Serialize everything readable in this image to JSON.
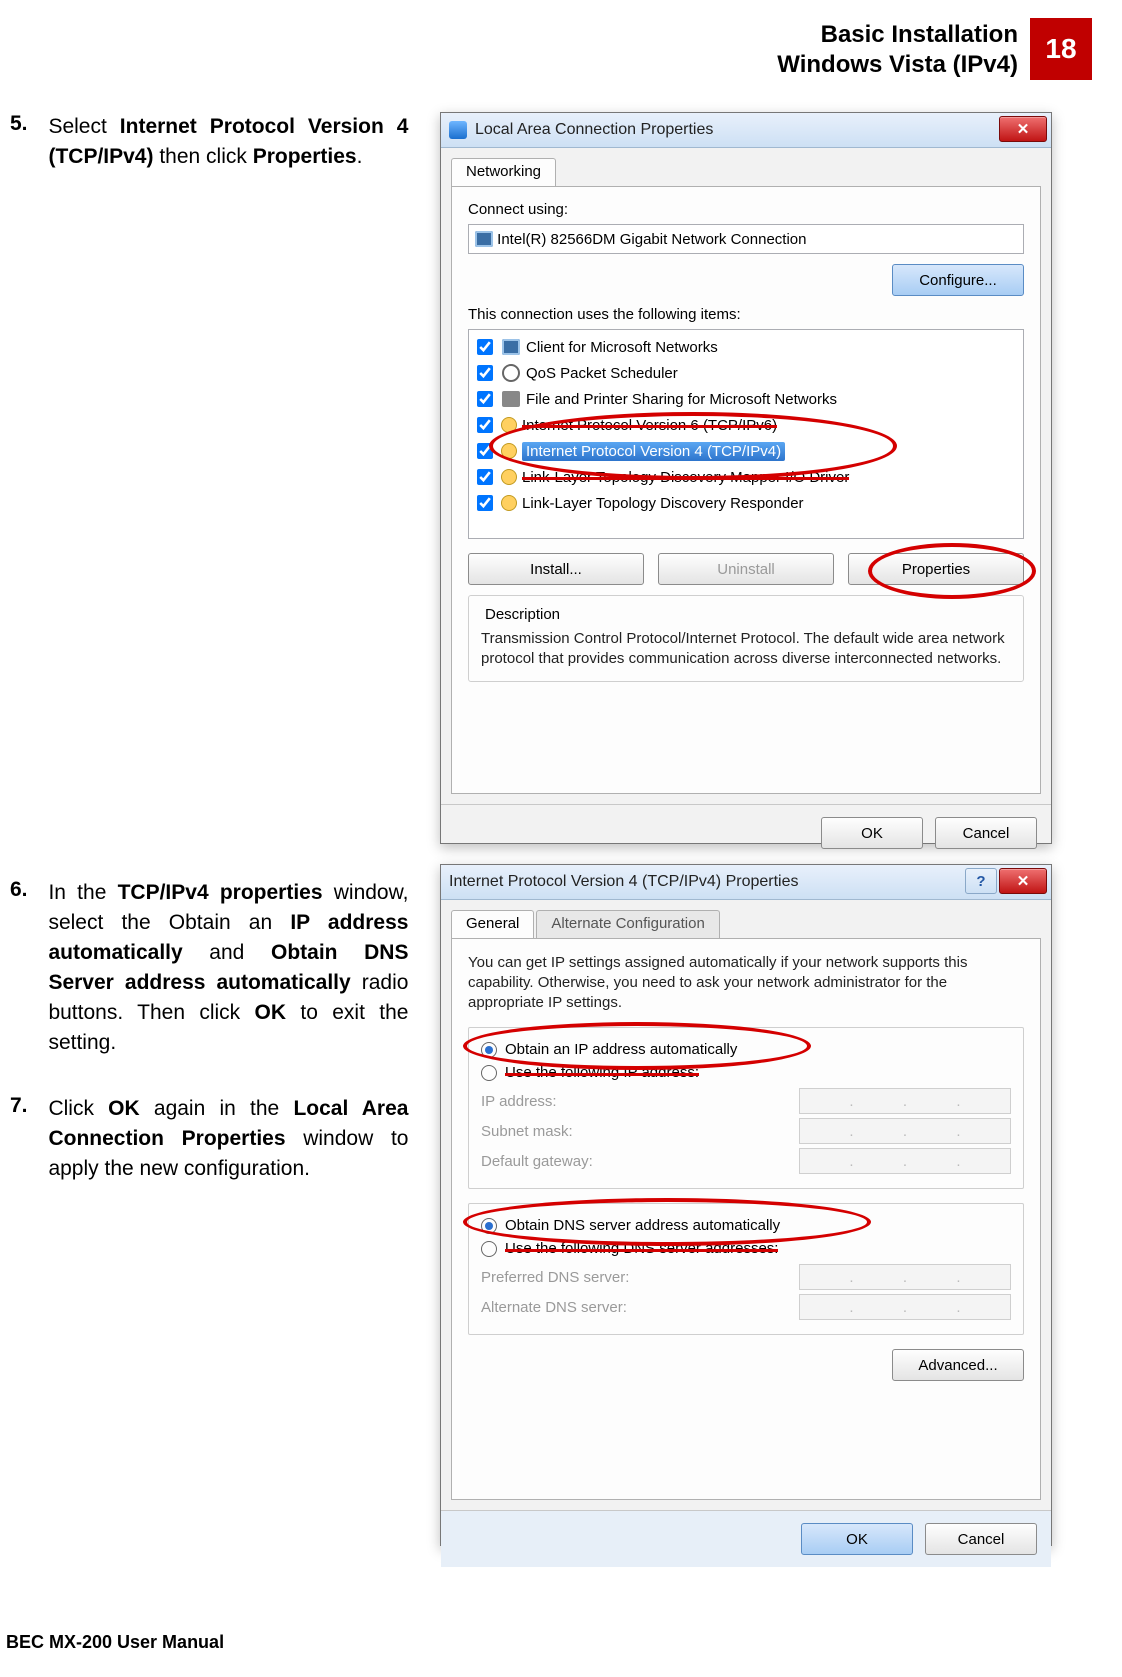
{
  "header": {
    "title_line1": "Basic Installation",
    "title_line2": "Windows Vista (IPv4)",
    "page_number": "18"
  },
  "steps": {
    "s5": {
      "num": "5.",
      "pre": "Select ",
      "b1": "Internet Protocol Version 4 (TCP/IPv4)",
      "mid": " then click ",
      "b2": "Properties",
      "post": "."
    },
    "s6": {
      "num": "6.",
      "pre": "In the ",
      "b1": "TCP/IPv4 properties",
      "mid1": " window, select the Obtain an ",
      "b2": "IP address automatically",
      "mid2": " and ",
      "b3": "Obtain DNS Server address automatically",
      "mid3": " radio buttons. Then click ",
      "b4": "OK",
      "post": " to exit the setting."
    },
    "s7": {
      "num": "7.",
      "pre": "Click ",
      "b1": "OK",
      "mid1": " again in the ",
      "b2": "Local Area Connection Properties",
      "post": " window to apply the new configuration."
    }
  },
  "dialog1": {
    "title": "Local Area Connection Properties",
    "tab": "Networking",
    "connect_using_label": "Connect using:",
    "adapter": "Intel(R) 82566DM Gigabit Network Connection",
    "configure": "Configure...",
    "items_label": "This connection uses the following items:",
    "items": [
      "Client for Microsoft Networks",
      "QoS Packet Scheduler",
      "File and Printer Sharing for Microsoft Networks",
      "Internet Protocol Version 6 (TCP/IPv6)",
      "Internet Protocol Version 4 (TCP/IPv4)",
      "Link-Layer Topology Discovery Mapper I/O Driver",
      "Link-Layer Topology Discovery Responder"
    ],
    "install": "Install...",
    "uninstall": "Uninstall",
    "properties": "Properties",
    "desc_label": "Description",
    "desc_text": "Transmission Control Protocol/Internet Protocol. The default wide area network protocol that provides communication across diverse interconnected networks.",
    "ok": "OK",
    "cancel": "Cancel"
  },
  "dialog2": {
    "title": "Internet Protocol Version 4 (TCP/IPv4) Properties",
    "tab1": "General",
    "tab2": "Alternate Configuration",
    "intro": "You can get IP settings assigned automatically if your network supports this capability. Otherwise, you need to ask your network administrator for the appropriate IP settings.",
    "r1": "Obtain an IP address automatically",
    "r2": "Use the following IP address:",
    "ip_label": "IP address:",
    "mask_label": "Subnet mask:",
    "gw_label": "Default gateway:",
    "r3": "Obtain DNS server address automatically",
    "r4": "Use the following DNS server addresses:",
    "pdns_label": "Preferred DNS server:",
    "adns_label": "Alternate DNS server:",
    "advanced": "Advanced...",
    "ok": "OK",
    "cancel": "Cancel"
  },
  "footer": "BEC MX-200 User Manual"
}
